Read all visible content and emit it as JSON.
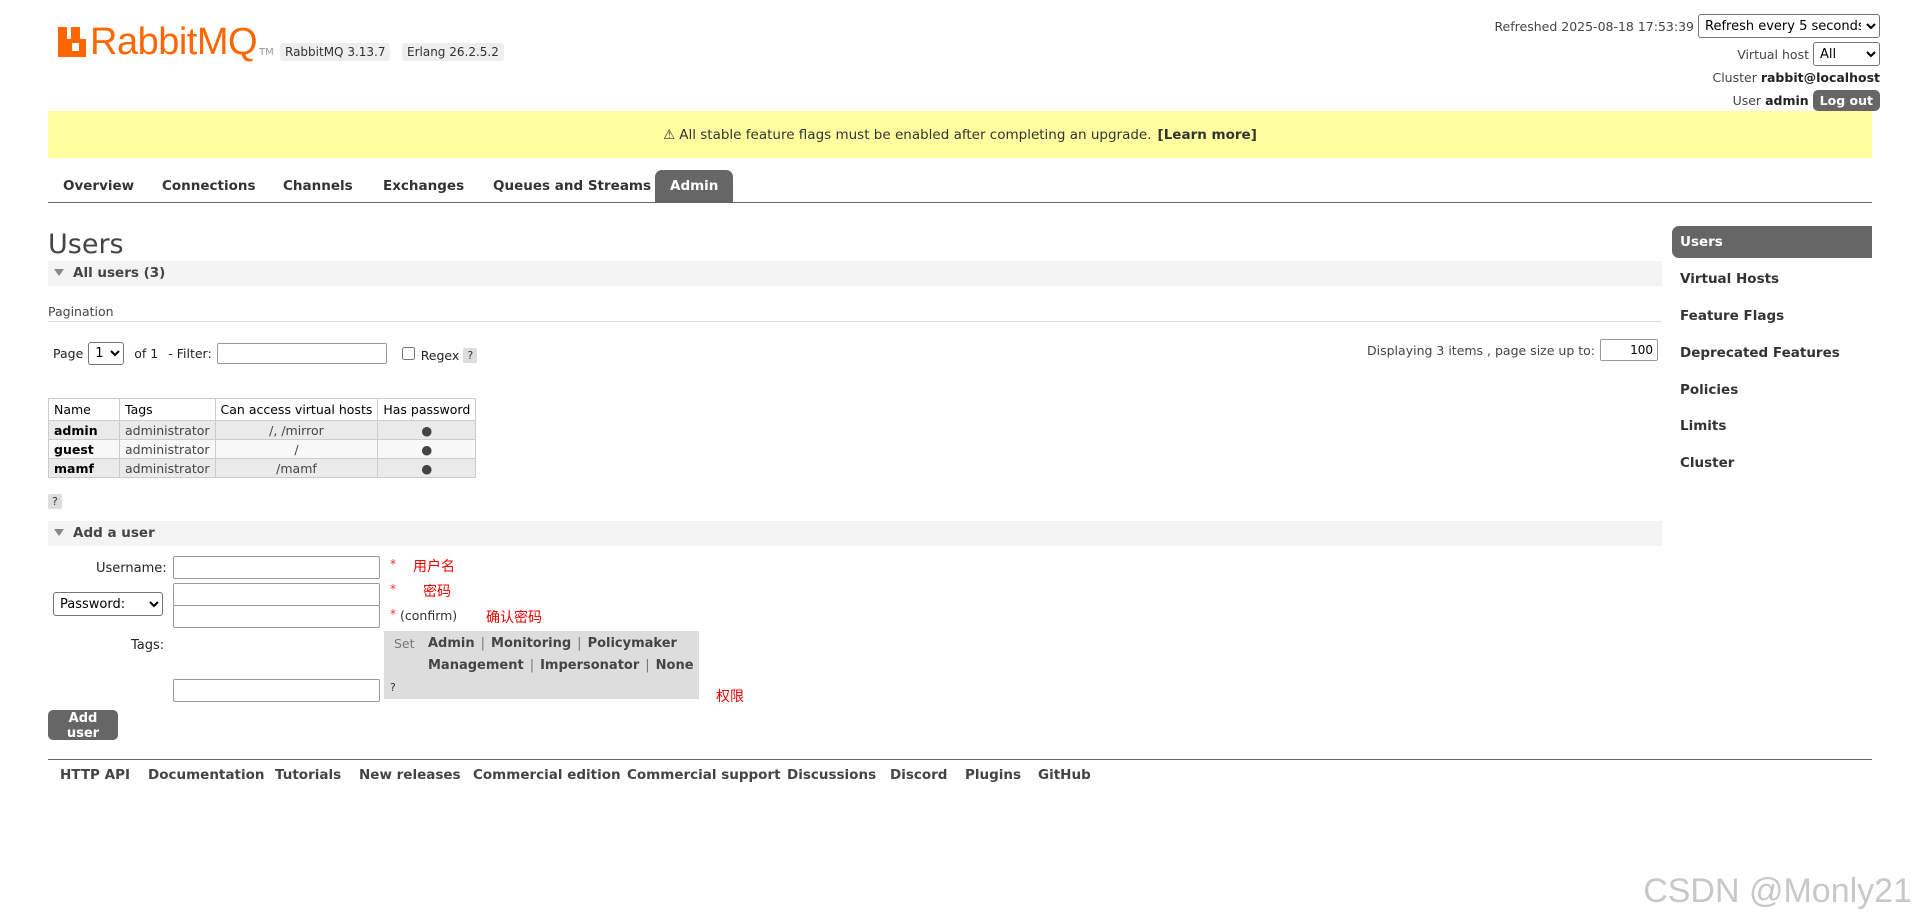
{
  "header": {
    "logo_text": "RabbitMQ",
    "logo_tm": "TM",
    "rabbitmq_version": "RabbitMQ 3.13.7",
    "erlang_version": "Erlang 26.2.5.2",
    "refreshed": "Refreshed 2025-08-18 17:53:39",
    "refresh_option": "Refresh every 5 seconds",
    "virtual_host_label": "Virtual host",
    "virtual_host_value": "All",
    "cluster_label": "Cluster",
    "cluster_value": "rabbit@localhost",
    "user_label": "User",
    "user_value": "admin",
    "logout_label": "Log out"
  },
  "banner": {
    "icon": "warning-icon",
    "icon_glyph": "⚠",
    "text": "All stable feature flags must be enabled after completing an upgrade.",
    "link": "[Learn more]"
  },
  "tabs": [
    "Overview",
    "Connections",
    "Channels",
    "Exchanges",
    "Queues and Streams",
    "Admin"
  ],
  "active_tab": "Admin",
  "page_title": "Users",
  "all_users_section": {
    "title": "All users (3)",
    "pagination_label": "Pagination",
    "page_label": "Page",
    "page_value": "1",
    "of_label": "of 1",
    "filter_label": "- Filter:",
    "filter_value": "",
    "regex_label": "Regex",
    "help": "?",
    "displaying": "Displaying 3 items , page size up to:",
    "page_size": "100"
  },
  "users_table": {
    "columns": [
      "Name",
      "Tags",
      "Can access virtual hosts",
      "Has password"
    ],
    "rows": [
      {
        "name": "admin",
        "tags": "administrator",
        "vhosts": "/, /mirror",
        "has_password": "●"
      },
      {
        "name": "guest",
        "tags": "administrator",
        "vhosts": "/",
        "has_password": "●"
      },
      {
        "name": "mamf",
        "tags": "administrator",
        "vhosts": "/mamf",
        "has_password": "●"
      }
    ]
  },
  "add_user_section": {
    "title": "Add a user",
    "username_label": "Username:",
    "password_option": "Password:",
    "confirm_label": "(confirm)",
    "required_mark": "*",
    "tags_label": "Tags:",
    "set_label": "Set",
    "tag_options_row1": [
      "Admin",
      "Monitoring",
      "Policymaker"
    ],
    "tag_options_row2": [
      "Management",
      "Impersonator",
      "None"
    ],
    "separator": "|",
    "help": "?",
    "submit_label": "Add user",
    "annotations": {
      "username": "用户名",
      "password": "密码",
      "confirm": "确认密码",
      "tags": "权限"
    }
  },
  "sidebar": [
    "Users",
    "Virtual Hosts",
    "Feature Flags",
    "Deprecated Features",
    "Policies",
    "Limits",
    "Cluster"
  ],
  "sidebar_active": "Users",
  "footer": [
    "HTTP API",
    "Documentation",
    "Tutorials",
    "New releases",
    "Commercial edition",
    "Commercial support",
    "Discussions",
    "Discord",
    "Plugins",
    "GitHub"
  ],
  "watermark": "CSDN @Monly21",
  "colors": {
    "brand": "#ff6600",
    "banner": "#ffffa0",
    "active_tab": "#666666",
    "annotation": "#ee0000"
  }
}
